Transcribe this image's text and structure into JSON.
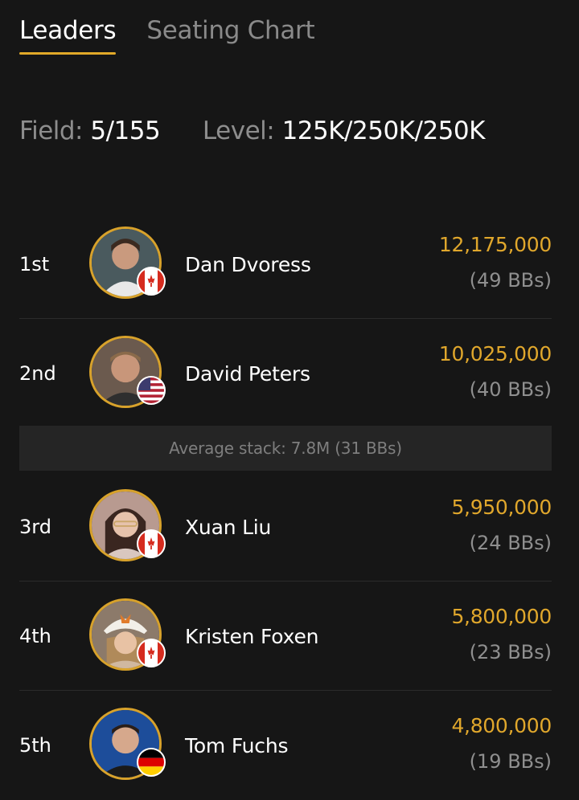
{
  "tabs": [
    {
      "label": "Leaders",
      "active": true
    },
    {
      "label": "Seating Chart",
      "active": false
    }
  ],
  "stats": {
    "field_label": "Field:",
    "field_value": "5/155",
    "level_label": "Level:",
    "level_value": "125K/250K/250K"
  },
  "average_stack": "Average stack: 7.8M (31 BBs)",
  "leaders": [
    {
      "rank": "1st",
      "name": "Dan Dvoress",
      "chips": "12,175,000",
      "bbs": "(49 BBs)",
      "flag": "canada-flag-icon"
    },
    {
      "rank": "2nd",
      "name": "David Peters",
      "chips": "10,025,000",
      "bbs": "(40 BBs)",
      "flag": "usa-flag-icon"
    },
    {
      "rank": "3rd",
      "name": "Xuan Liu",
      "chips": "5,950,000",
      "bbs": "(24 BBs)",
      "flag": "canada-flag-icon"
    },
    {
      "rank": "4th",
      "name": "Kristen Foxen",
      "chips": "5,800,000",
      "bbs": "(23 BBs)",
      "flag": "canada-flag-icon"
    },
    {
      "rank": "5th",
      "name": "Tom Fuchs",
      "chips": "4,800,000",
      "bbs": "(19 BBs)",
      "flag": "germany-flag-icon"
    }
  ],
  "colors": {
    "background": "#161616",
    "accent": "#e0a72c",
    "muted": "#8d8d8d"
  }
}
